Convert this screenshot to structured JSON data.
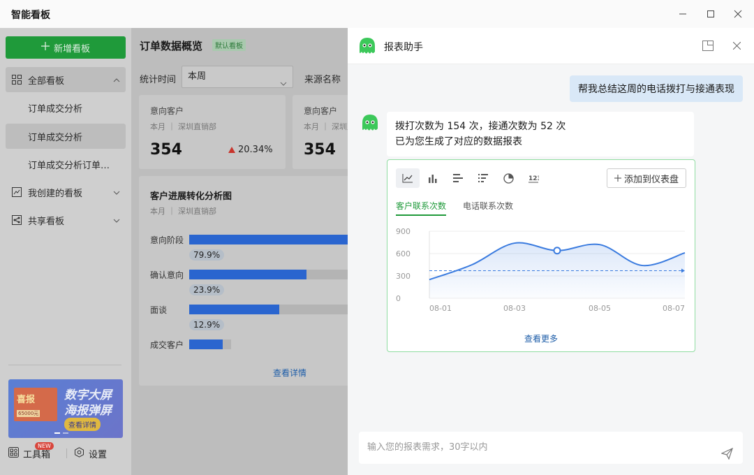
{
  "window": {
    "title": "智能看板"
  },
  "sidebar": {
    "new_board": "新增看板",
    "all_boards": "全部看板",
    "sub_items": [
      "订单成交分析",
      "订单成交分析",
      "订单成交分析订单…"
    ],
    "my_boards": "我创建的看板",
    "shared_boards": "共享看板",
    "banner": {
      "line1": "数字大屏",
      "line2": "海报弹屏",
      "button": "查看详情",
      "tag": "喜报",
      "amount": "65000元"
    },
    "tools": "工具箱",
    "tools_badge": "NEW",
    "settings": "设置"
  },
  "main": {
    "title": "订单数据概览",
    "default_tag": "默认看板",
    "filter_time_label": "统计时间",
    "filter_time_value": "本周",
    "filter_source_label": "来源名称",
    "kpis": [
      {
        "label": "意向客户",
        "sub": "本月 ｜ 深圳直销部",
        "value": "354",
        "rate": "20.34%"
      },
      {
        "label": "意向客户",
        "sub": "本月 ｜ 深圳直销部",
        "value": "354"
      }
    ],
    "funnel": {
      "title": "客户进展转化分析图",
      "sub": "本月 ｜ 深圳直销部",
      "stages": [
        {
          "label": "意向阶段",
          "rate": "79.9%",
          "fill": 1.0
        },
        {
          "label": "确认意向",
          "rate": "23.9%",
          "fill": 0.73
        },
        {
          "label": "面谈",
          "rate": "12.9%",
          "fill": 0.56
        },
        {
          "label": "成交客户",
          "fill": 0.21
        }
      ],
      "detail_link": "查看详情"
    }
  },
  "assistant": {
    "name": "报表助手",
    "user_message": "帮我总结这周的电话拨打与接通表现",
    "bot_line1": "拨打次数为 154 次，接通次数为 52 次",
    "bot_line2": "已为您生成了对应的数据报表",
    "chart_types": [
      "line-chart-icon",
      "bar-chart-icon",
      "horizontal-bar-icon",
      "sorted-bar-icon",
      "pie-chart-icon",
      "number-icon"
    ],
    "add_to_dashboard": "添加到仪表盘",
    "tabs": [
      "客户联系次数",
      "电话联系次数"
    ],
    "more": "查看更多",
    "input_placeholder": "输入您的报表需求，30字以内",
    "accent_color": "#1f9a3a"
  },
  "chart_data": {
    "type": "line",
    "x": [
      "08-01",
      "08-02",
      "08-03",
      "08-04",
      "08-05",
      "08-06",
      "08-07"
    ],
    "xticks": [
      "08-01",
      "08-03",
      "08-05",
      "08-07"
    ],
    "values": [
      250,
      450,
      740,
      640,
      720,
      440,
      610
    ],
    "average": 370,
    "ylim": [
      0,
      900
    ],
    "yticks": [
      "900",
      "600",
      "300",
      "0"
    ],
    "highlight_index": 3
  }
}
